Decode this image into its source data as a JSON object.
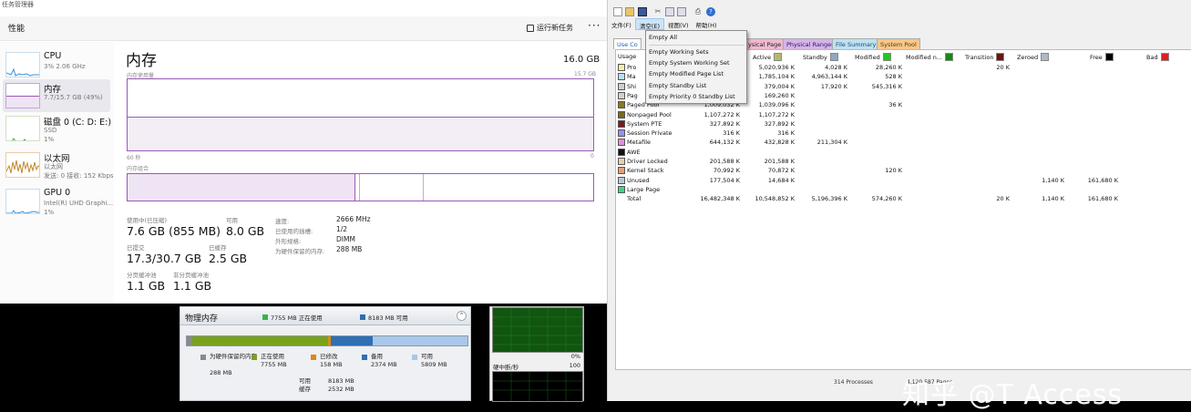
{
  "task_manager": {
    "window_title": "任务管理器",
    "header": {
      "title": "性能",
      "run_task": "运行新任务",
      "more": "···"
    },
    "sidebar": [
      {
        "name": "CPU",
        "line1": "3% 2.06 GHz",
        "line2": ""
      },
      {
        "name": "内存",
        "line1": "7.7/15.7 GB (49%)",
        "line2": ""
      },
      {
        "name": "磁盘 0 (C: D: E:)",
        "line1": "SSD",
        "line2": "1%"
      },
      {
        "name": "以太网",
        "line1": "以太网",
        "line2": "发送: 0 接收: 152 Kbps"
      },
      {
        "name": "GPU 0",
        "line1": "Intel(R) UHD Graphi...",
        "line2": "1%"
      }
    ],
    "memory": {
      "title": "内存",
      "total": "16.0 GB",
      "usage_label": "内存使用量",
      "usage_max": "15.7 GB",
      "time_left": "60 秒",
      "time_right": "0",
      "composition_label": "内存组合",
      "stats": {
        "in_use_label": "使用中(已压缩)",
        "in_use": "7.6 GB (855 MB)",
        "available_label": "可用",
        "available": "8.0 GB",
        "committed_label": "已提交",
        "committed": "17.3/30.7 GB",
        "cached_label": "已缓存",
        "cached": "2.5 GB",
        "paged_label": "分页缓冲池",
        "paged": "1.1 GB",
        "nonpaged_label": "非分页缓冲池",
        "nonpaged": "1.1 GB"
      },
      "kv": [
        {
          "k": "速度:",
          "v": "2666 MHz"
        },
        {
          "k": "已使用的插槽:",
          "v": "1/2"
        },
        {
          "k": "外形规格:",
          "v": "DIMM"
        },
        {
          "k": "为硬件保留的内存:",
          "v": "288 MB"
        }
      ]
    }
  },
  "resource_monitor": {
    "title": "物理内存",
    "legend_used": "7755 MB 正在使用",
    "legend_avail": "8183 MB 可用",
    "bar_legend": [
      {
        "label": "为硬件保留的内存",
        "value": "288 MB",
        "color": "#8a8a8a"
      },
      {
        "label": "正在使用",
        "value": "7755 MB",
        "color": "#7aa11c"
      },
      {
        "label": "已修改",
        "value": "158 MB",
        "color": "#e08a14"
      },
      {
        "label": "备用",
        "value": "2374 MB",
        "color": "#2f6fb4"
      },
      {
        "label": "可用",
        "value": "5809 MB",
        "color": "#a9c7e8"
      }
    ],
    "totals": [
      {
        "k": "可用",
        "v": "8183 MB"
      },
      {
        "k": "缓存",
        "v": "2532 MB"
      }
    ],
    "bar_fractions": [
      0.018,
      0.485,
      0.01,
      0.149,
      0.338
    ]
  },
  "graphs_panel": {
    "pct": "0%",
    "label": "硬中断/秒",
    "max": "100"
  },
  "rammap": {
    "menu": [
      "文件(F)",
      "清空(E)",
      "视图(V)",
      "帮助(H)"
    ],
    "tabs": [
      "Use Co",
      "ysical Page",
      "Physical Ranges",
      "File Summary",
      "System Pool"
    ],
    "dropdown": [
      "Empty All",
      "Empty Working Sets",
      "Empty System Working Set",
      "Empty Modified Page List",
      "Empty Standby List",
      "Empty Priority 0 Standby List"
    ],
    "headers": [
      {
        "label": "Usage",
        "color": ""
      },
      {
        "label": "Active",
        "color": "#b8b86c"
      },
      {
        "label": "Standby",
        "color": "#8fa6c2"
      },
      {
        "label": "Modified",
        "color": "#1fc71f"
      },
      {
        "label": "Modified n...",
        "color": "#138a13"
      },
      {
        "label": "Transition",
        "color": "#6b1212"
      },
      {
        "label": "Zeroed",
        "color": "#b0b8c6"
      },
      {
        "label": "Free",
        "color": "#000000"
      },
      {
        "label": "Bad",
        "color": "#e02020"
      }
    ],
    "rows": [
      {
        "name": "Pro",
        "color": "#f2efa0",
        "c": [
          "",
          "5,020,936 K",
          "4,028 K",
          "28,260 K",
          "",
          "20 K",
          "",
          "",
          ""
        ]
      },
      {
        "name": "Ma",
        "color": "#b8dff5",
        "c": [
          "",
          "1,785,104 K",
          "4,963,144 K",
          "528 K",
          "",
          "",
          "",
          "",
          ""
        ]
      },
      {
        "name": "Shi",
        "color": "#cfcfcf",
        "c": [
          "",
          "379,004 K",
          "17,920 K",
          "545,316 K",
          "",
          "",
          "",
          "",
          ""
        ]
      },
      {
        "name": "Pag",
        "color": "#d8d0c4",
        "c": [
          "",
          "169,260 K",
          "",
          "",
          "",
          "",
          "",
          "",
          ""
        ]
      },
      {
        "name": "Paged Pool",
        "color": "#8a7a1a",
        "c": [
          "1,009,032 K",
          "1,039,096 K",
          "",
          "36 K",
          "",
          "",
          "",
          "",
          ""
        ]
      },
      {
        "name": "Nonpaged Pool",
        "color": "#7a6a18",
        "c": [
          "1,107,272 K",
          "1,107,272 K",
          "",
          "",
          "",
          "",
          "",
          "",
          ""
        ]
      },
      {
        "name": "System PTE",
        "color": "#7a1a1a",
        "c": [
          "327,892 K",
          "327,892 K",
          "",
          "",
          "",
          "",
          "",
          "",
          ""
        ]
      },
      {
        "name": "Session Private",
        "color": "#9e8ef0",
        "c": [
          "316 K",
          "316 K",
          "",
          "",
          "",
          "",
          "",
          "",
          ""
        ]
      },
      {
        "name": "Metafile",
        "color": "#e88ae0",
        "c": [
          "644,132 K",
          "432,828 K",
          "211,304 K",
          "",
          "",
          "",
          "",
          "",
          ""
        ]
      },
      {
        "name": "AWE",
        "color": "#111111",
        "c": [
          "",
          "",
          "",
          "",
          "",
          "",
          "",
          "",
          ""
        ]
      },
      {
        "name": "Driver Locked",
        "color": "#e8d0a8",
        "c": [
          "201,588 K",
          "201,588 K",
          "",
          "",
          "",
          "",
          "",
          "",
          ""
        ]
      },
      {
        "name": "Kernel Stack",
        "color": "#e8a070",
        "c": [
          "70,992 K",
          "70,872 K",
          "",
          "120 K",
          "",
          "",
          "",
          "",
          ""
        ]
      },
      {
        "name": "Unused",
        "color": "#b8c8d8",
        "c": [
          "177,504 K",
          "14,684 K",
          "",
          "",
          "",
          "",
          "1,140 K",
          "161,680 K",
          ""
        ]
      },
      {
        "name": "Large Page",
        "color": "#3ad87a",
        "c": [
          "",
          "",
          "",
          "",
          "",
          "",
          "",
          "",
          ""
        ]
      },
      {
        "name": "Total",
        "color": "",
        "c": [
          "16,482,348 K",
          "10,548,852 K",
          "5,196,396 K",
          "574,260 K",
          "",
          "20 K",
          "1,140 K",
          "161,680 K",
          ""
        ]
      }
    ],
    "status_left": "314 Processes",
    "status_right": "4,120,587 Pages"
  },
  "watermark": "知乎 @T Access"
}
